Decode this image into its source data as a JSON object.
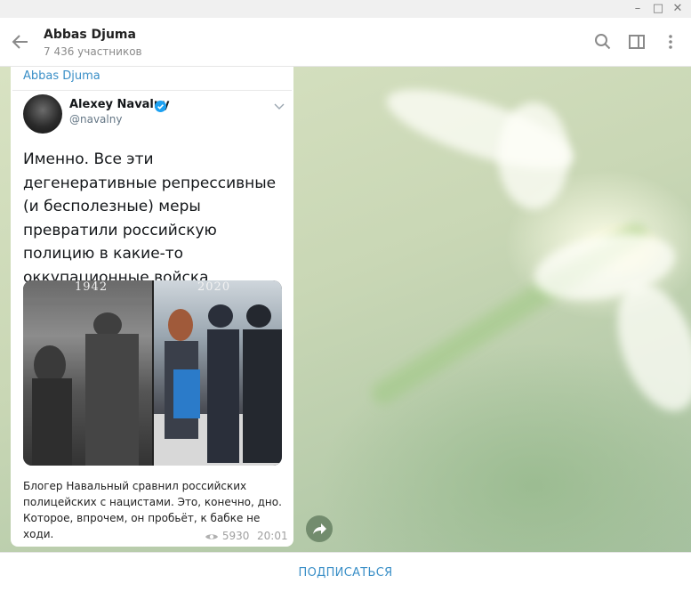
{
  "window": {
    "minimize": "–",
    "maximize": "□",
    "close": "✕"
  },
  "header": {
    "title": "Abbas Djuma",
    "subtitle": "7 436 участников",
    "icons": [
      "back-arrow-icon",
      "search-icon",
      "sidebar-toggle-icon",
      "more-vert-icon"
    ]
  },
  "post": {
    "author": "Abbas Djuma",
    "tweet": {
      "name": "Alexey Navalny",
      "handle": "@navalny",
      "text": "Именно. Все эти дегенеративные репрессивные (и бесполезные) меры превратили российскую полицию в какие-то оккупационные войска",
      "photo": {
        "left_label": "1942",
        "right_label": "2020"
      }
    },
    "caption": "Блогер Навальный сравнил российских полицейских с нацистами. Это, конечно, дно. Которое, впрочем, он пробьёт, к бабке не ходи.",
    "views": "5930",
    "time": "20:01"
  },
  "footer": {
    "subscribe": "ПОДПИСАТЬСЯ"
  },
  "colors": {
    "accent": "#3a8fc7",
    "verified": "#1da1f2"
  }
}
